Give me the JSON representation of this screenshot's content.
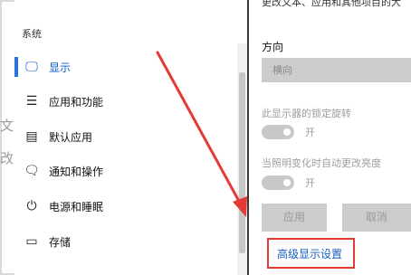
{
  "background_leak": {
    "line1": "文",
    "line2": "改"
  },
  "sidebar": {
    "section_label": "系统",
    "items": [
      {
        "icon": "monitor-icon",
        "glyph": "🖵",
        "label": "显示",
        "active": true
      },
      {
        "icon": "apps-list-icon",
        "glyph": "☰",
        "label": "应用和功能",
        "active": false
      },
      {
        "icon": "default-apps-icon",
        "glyph": "▤",
        "label": "默认应用",
        "active": false
      },
      {
        "icon": "notification-icon",
        "glyph": "🗨",
        "label": "通知和操作",
        "active": false
      },
      {
        "icon": "power-icon",
        "glyph": "⏻",
        "label": "电源和睡眠",
        "active": false
      },
      {
        "icon": "storage-icon",
        "glyph": "▭",
        "label": "存储",
        "active": false
      }
    ]
  },
  "content": {
    "cut_off_text": "更改文本、应用和其他项目的大",
    "orientation": {
      "title": "方向",
      "value": "横向"
    },
    "rotation_lock": {
      "label": "此显示器的锁定旋转",
      "state": "开"
    },
    "auto_brightness": {
      "label": "当照明变化时自动更改亮度",
      "state": "开"
    },
    "apply_button": "应用",
    "cancel_button": "取消",
    "advanced_link": "高级显示设置"
  },
  "colors": {
    "accent": "#0a58c2",
    "annotation_red": "#e53935"
  }
}
